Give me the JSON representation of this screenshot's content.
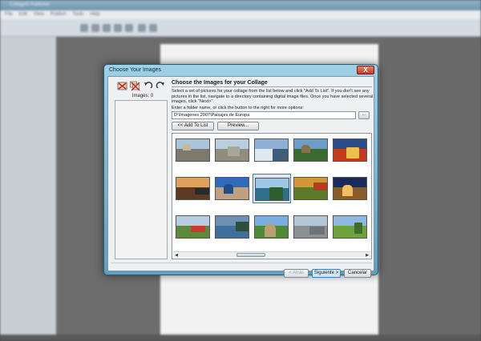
{
  "background_app": {
    "title": "CollageIt Publisher",
    "menu": [
      "File",
      "Edit",
      "View",
      "Publish",
      "Tools",
      "Help"
    ]
  },
  "dialog": {
    "title": "Choose Your Images",
    "close_label": "X",
    "images_count": "Images: 0",
    "section_title": "Choose the Images for your Collage",
    "description": "Select a set of pictures for your collage from the list below and click \"Add To List\". If you don't see any pictures in the list, navigate to a directory containing digital image files. Once you have selected several images, click \"Next>\".",
    "folder_label": "Enter a folder name, or click the button to the right for more options:",
    "folder_path": "D:\\Imagenes 2007\\Paisajes de Europa",
    "browse_label": "...",
    "add_to_list": "<< Add To List",
    "preview": "Preview...",
    "back": "< Atrás",
    "next": "Siguiente >",
    "cancel": "Cancelar",
    "thumbnails": [
      {
        "sky": "#aac4dc",
        "land": "#7c7a6a",
        "feat": "#c8b89a"
      },
      {
        "sky": "#b9cfe0",
        "land": "#8f8d7c",
        "feat": "#a9a69a"
      },
      {
        "sky": "#8fb0d6",
        "land": "#dfe7ef",
        "feat": "#3e5d7a"
      },
      {
        "sky": "#6d9dc9",
        "land": "#3b6b2f",
        "feat": "#8a7050"
      },
      {
        "sky": "#2b4a8a",
        "land": "#c23b1d",
        "feat": "#e8c04a"
      },
      {
        "sky": "#e0a060",
        "land": "#5c3a24",
        "feat": "#2a2a2a"
      },
      {
        "sky": "#2f6bb8",
        "land": "#c0a080",
        "feat": "#1e4e8e"
      },
      {
        "sky": "#9cc7e6",
        "land": "#2c6f8f",
        "feat": "#2f5e2a"
      },
      {
        "sky": "#d59638",
        "land": "#5d7a2a",
        "feat": "#b43d1f"
      },
      {
        "sky": "#1b2a5e",
        "land": "#8a5c2a",
        "feat": "#f0c060"
      },
      {
        "sky": "#b7cde3",
        "land": "#5c8a3a",
        "feat": "#c83a2a"
      },
      {
        "sky": "#6d8fb4",
        "land": "#3f6f9a",
        "feat": "#2f4e3a"
      },
      {
        "sky": "#7aaee0",
        "land": "#4e8a36",
        "feat": "#b8a070"
      },
      {
        "sky": "#b3c6d6",
        "land": "#8c8f92",
        "feat": "#6e7276"
      },
      {
        "sky": "#8fb9e2",
        "land": "#6ea23c",
        "feat": "#3f6e2a"
      }
    ],
    "selected_index": 7
  }
}
